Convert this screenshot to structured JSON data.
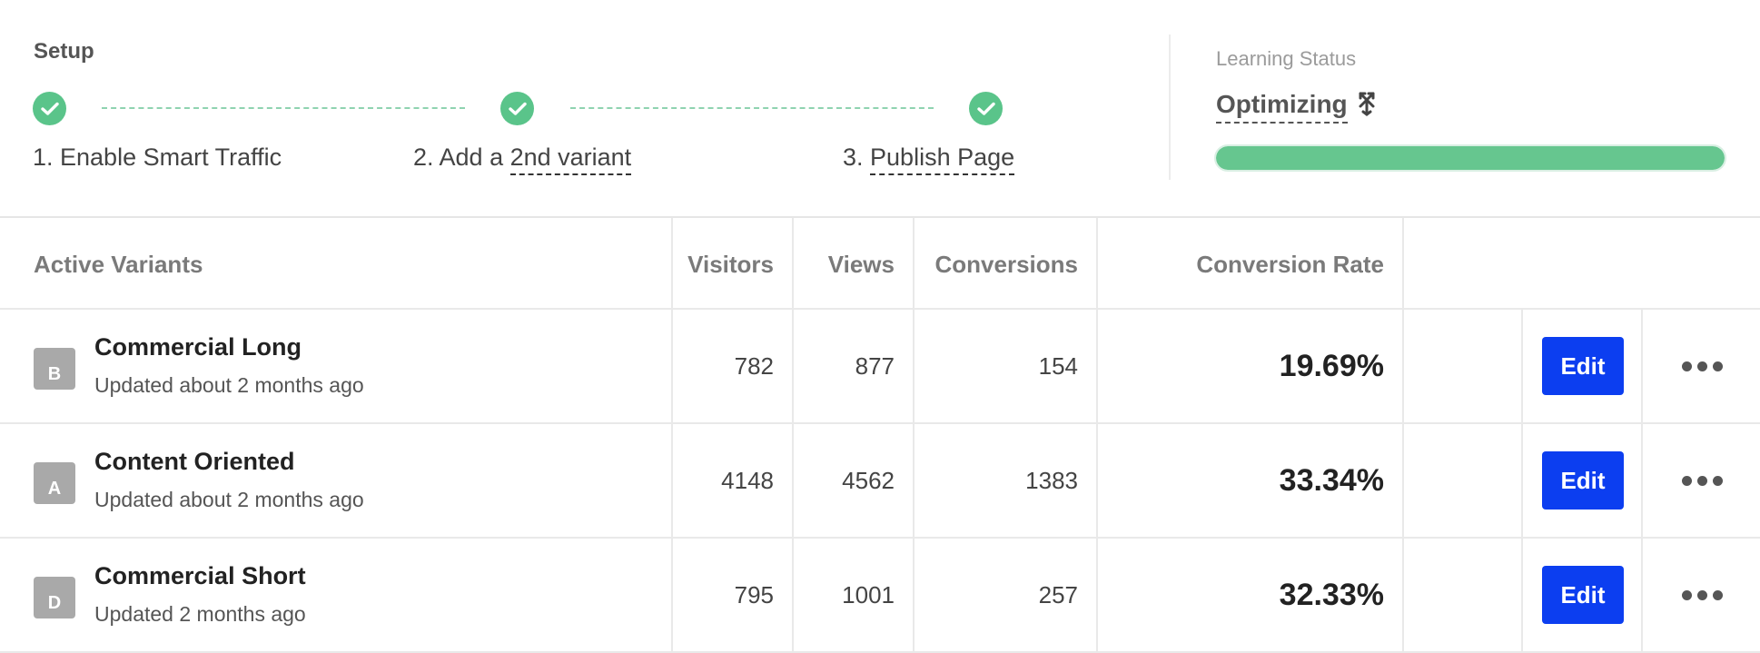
{
  "setup": {
    "title": "Setup",
    "steps": [
      {
        "label_prefix": "1. Enable Smart Traffic",
        "label_link": "",
        "icon": "check-icon"
      },
      {
        "label_prefix": "2. Add a ",
        "label_link": "2nd variant",
        "icon": "check-icon"
      },
      {
        "label_prefix": "3. ",
        "label_link": "Publish Page",
        "icon": "check-icon"
      }
    ]
  },
  "learning": {
    "title": "Learning Status",
    "status": "Optimizing",
    "status_icon": "split-arrows-icon",
    "progress": 1.0,
    "progress_color": "#66c68f"
  },
  "table": {
    "headers": {
      "name": "Active Variants",
      "visitors": "Visitors",
      "views": "Views",
      "conversions": "Conversions",
      "rate": "Conversion Rate"
    },
    "rows": [
      {
        "badge": "B",
        "name": "Commercial Long",
        "updated": "Updated about 2 months ago",
        "visitors": "782",
        "views": "877",
        "conversions": "154",
        "rate": "19.69%",
        "edit": "Edit",
        "more_icon": "more-icon"
      },
      {
        "badge": "A",
        "name": "Content Oriented",
        "updated": "Updated about 2 months ago",
        "visitors": "4148",
        "views": "4562",
        "conversions": "1383",
        "rate": "33.34%",
        "edit": "Edit",
        "more_icon": "more-icon"
      },
      {
        "badge": "D",
        "name": "Commercial Short",
        "updated": "Updated 2 months ago",
        "visitors": "795",
        "views": "1001",
        "conversions": "257",
        "rate": "32.33%",
        "edit": "Edit",
        "more_icon": "more-icon"
      }
    ]
  },
  "colors": {
    "accent_button": "#0c3ef0",
    "check_green": "#5ac48a",
    "badge_gray": "#a9a9a9"
  }
}
